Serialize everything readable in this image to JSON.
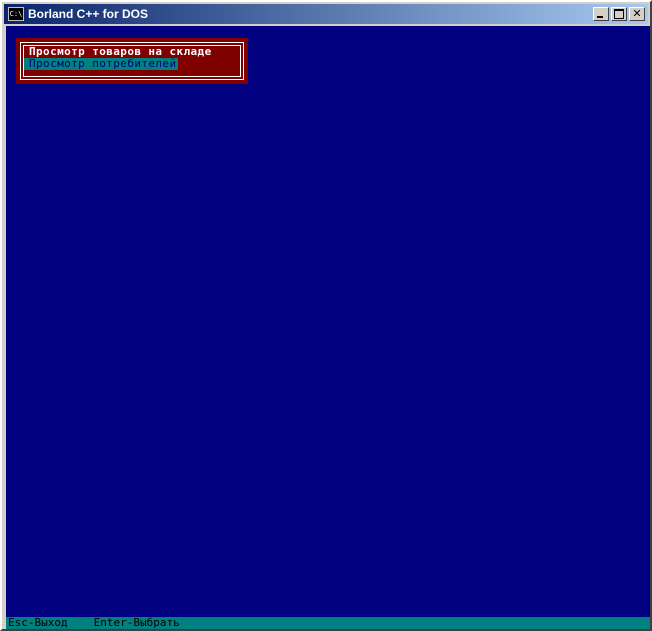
{
  "window": {
    "title": "Borland C++ for DOS",
    "icon_text": "C:\\",
    "close_glyph": "✕"
  },
  "menu": {
    "items": [
      {
        "label": "Просмотр товаров на складе",
        "selected": false
      },
      {
        "label": "Просмотр потребителей",
        "selected": true
      }
    ]
  },
  "statusbar": {
    "items": [
      {
        "label": "Esc-Выход"
      },
      {
        "label": "Enter-Выбрать"
      }
    ]
  },
  "colors": {
    "console_background": "#000080",
    "menu_background": "#800000",
    "highlight": "#008080",
    "text_white": "#ffffff"
  }
}
